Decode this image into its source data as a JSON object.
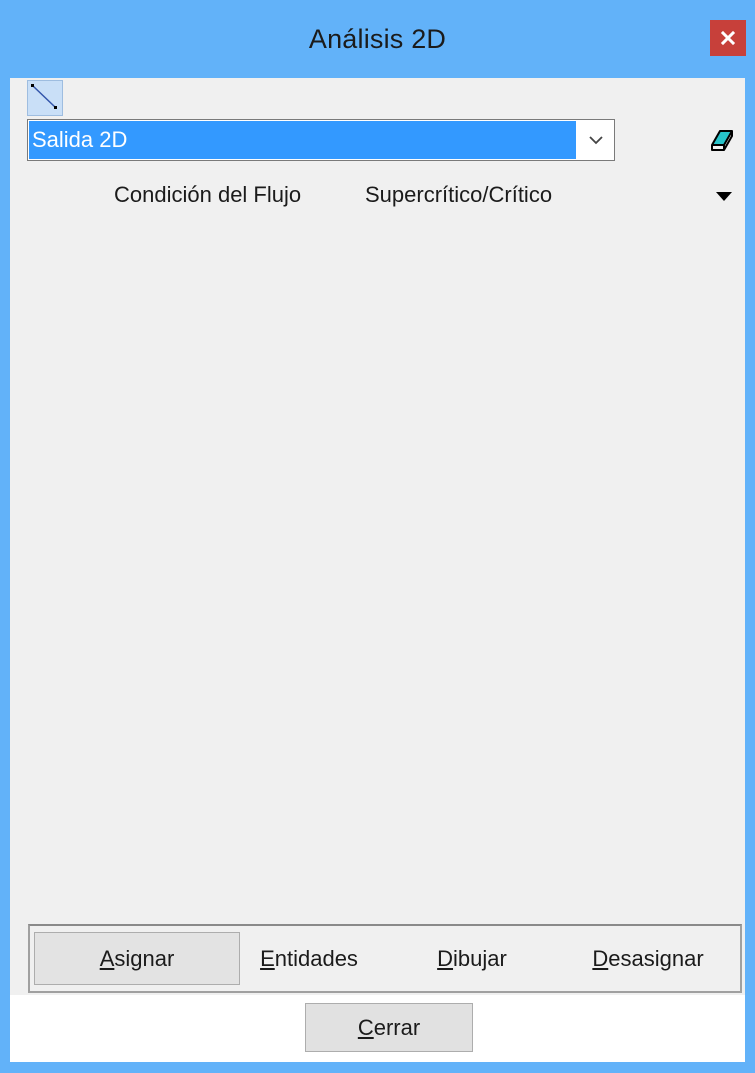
{
  "window": {
    "title": "Análisis 2D",
    "close_icon": "close-icon"
  },
  "toolbar": {
    "tool_icon": "line-entity-icon"
  },
  "combo": {
    "value": "Salida 2D",
    "arrow_icon": "chevron-down-icon",
    "edit_icon": "eraser-edit-icon"
  },
  "condition": {
    "label": "Condición del Flujo",
    "value": "Supercrítico/Crítico",
    "dropdown_icon": "triangle-down-icon"
  },
  "actions": {
    "assign": {
      "mnemonic": "A",
      "rest": "signar"
    },
    "entities": {
      "mnemonic": "E",
      "rest": "ntidades"
    },
    "draw": {
      "mnemonic": "D",
      "rest": "ibujar"
    },
    "unassign": {
      "mnemonic": "D",
      "rest": "esasignar"
    }
  },
  "footer": {
    "close": {
      "mnemonic": "C",
      "rest": "errar"
    }
  },
  "colors": {
    "titlebar": "#62b2f9",
    "close_button": "#c7403a",
    "selection": "#3399ff",
    "panel": "#f0f0f0"
  }
}
